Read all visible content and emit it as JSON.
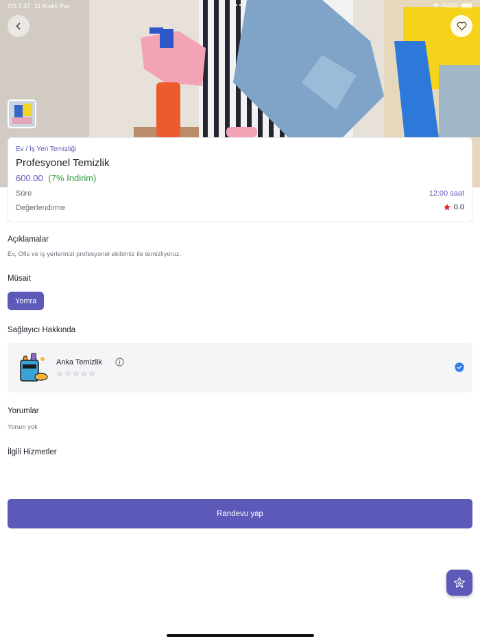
{
  "status_bar": {
    "time": "ÖS 7:37",
    "date": "11 Aralık Paz",
    "battery": "%100"
  },
  "hero": {
    "back_icon": "chevron-left-icon",
    "favorite_icon": "heart-icon"
  },
  "service": {
    "category": "Ev / İş Yeri Temizliği",
    "title": "Profesyonel Temizlik",
    "price": "600.00",
    "discount": "(7% İndirim)",
    "duration_label": "Süre",
    "duration_value": "12:00 saat",
    "rating_label": "Değerlendirme",
    "rating_value": "0.0"
  },
  "description": {
    "title": "Açıklamalar",
    "text": "Ev, Ofis ve iş yerlerinizi profesyonel ekibimiz ile temizliyoruz."
  },
  "availability": {
    "title": "Müsait",
    "location": "Yomra"
  },
  "provider": {
    "title": "Sağlayıcı Hakkında",
    "name": "Anka Temizlik",
    "stars": "☆☆☆☆☆"
  },
  "reviews": {
    "title": "Yorumlar",
    "empty_text": "Yorum yok"
  },
  "related": {
    "title": "İlgili Hizmetler"
  },
  "cta": {
    "label": "Randevu yap"
  },
  "colors": {
    "primary": "#5c59b8",
    "discount": "#2e9b3a",
    "star": "#e31b23",
    "verified": "#2e7be6"
  }
}
